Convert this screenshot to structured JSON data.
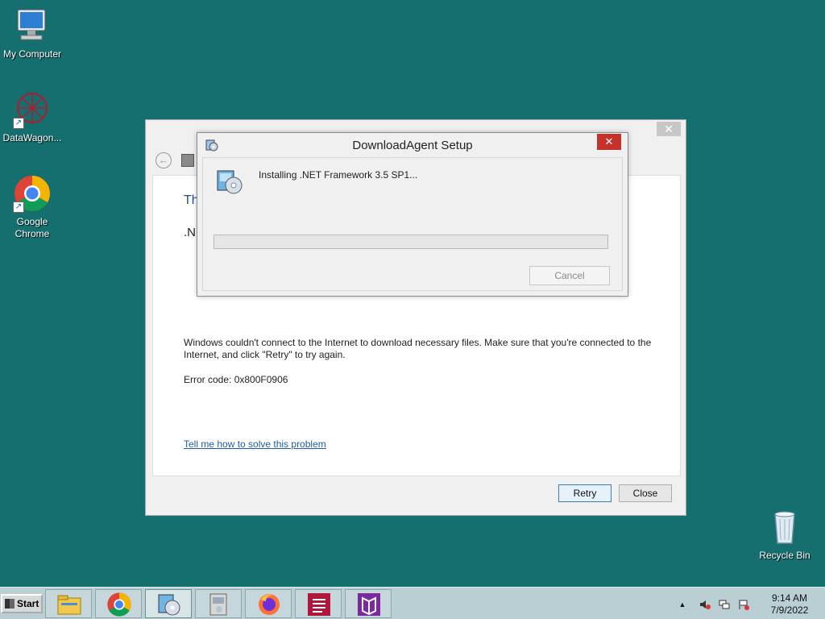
{
  "desktop": {
    "icons": [
      {
        "label": "My Computer",
        "icon": "computer-icon"
      },
      {
        "label": "DataWagon...",
        "icon": "datawagon-icon"
      },
      {
        "label": "Google Chrome",
        "icon": "chrome-icon"
      },
      {
        "label": "Recycle Bin",
        "icon": "recycle-bin-icon"
      }
    ]
  },
  "bg_window": {
    "heading_partial": "The",
    "subheading_partial": ".NE",
    "message": "Windows couldn't connect to the Internet to download necessary files. Make sure that you're connected to the Internet, and click \"Retry\" to try again.",
    "error_code": "Error code: 0x800F0906",
    "help_link": "Tell me how to solve this problem",
    "retry_label": "Retry",
    "close_label": "Close",
    "close_glyph": "✕",
    "back_glyph": "←"
  },
  "dialog": {
    "title": "DownloadAgent Setup",
    "status": "Installing .NET Framework 3.5 SP1...",
    "progress": 0,
    "cancel_label": "Cancel",
    "close_glyph": "✕"
  },
  "taskbar": {
    "start_label": "Start",
    "apps": [
      "file-explorer-icon",
      "chrome-icon",
      "setup-icon",
      "installer-icon",
      "firefox-icon",
      "app-red-icon",
      "app-purple-icon"
    ],
    "active_index": 2,
    "tray": {
      "expand_glyph": "▲",
      "time": "9:14 AM",
      "date": "7/9/2022"
    }
  },
  "colors": {
    "desktop": "#146f6e",
    "accent_link": "#1e5ea8",
    "close_red": "#c7312b"
  }
}
